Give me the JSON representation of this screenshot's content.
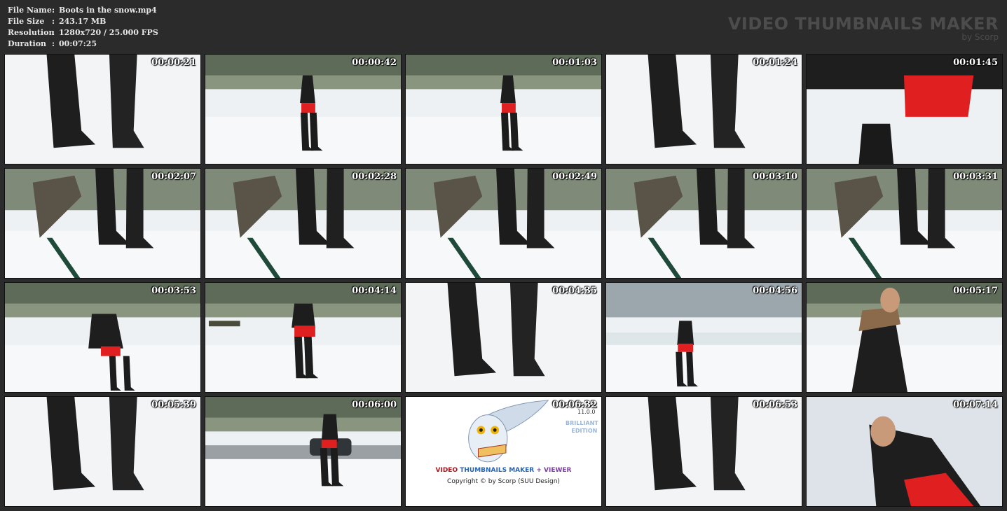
{
  "file_info": {
    "file_name_label": "File Name",
    "file_name": "Boots in the snow.mp4",
    "file_size_label": "File Size",
    "file_size": "243.17 MB",
    "resolution_label": "Resolution",
    "resolution": "1280x720 / 25.000 FPS",
    "duration_label": "Duration",
    "duration": "00:07:25",
    "separator": ":"
  },
  "brand": {
    "title": "VIDEO THUMBNAILS MAKER",
    "subtitle": "by Scorp"
  },
  "thumbnails": [
    {
      "time": "00:00:21",
      "scene": "boots-closeup"
    },
    {
      "time": "00:00:42",
      "scene": "walking-park"
    },
    {
      "time": "00:01:03",
      "scene": "walking-bag"
    },
    {
      "time": "00:01:24",
      "scene": "boots-closeup"
    },
    {
      "time": "00:01:45",
      "scene": "skirt-bag"
    },
    {
      "time": "00:02:07",
      "scene": "bench-boots"
    },
    {
      "time": "00:02:28",
      "scene": "bench-boots"
    },
    {
      "time": "00:02:49",
      "scene": "bench-boots"
    },
    {
      "time": "00:03:10",
      "scene": "bench-boots"
    },
    {
      "time": "00:03:31",
      "scene": "bench-boots"
    },
    {
      "time": "00:03:53",
      "scene": "woman-bag"
    },
    {
      "time": "00:04:14",
      "scene": "walking-away"
    },
    {
      "time": "00:04:35",
      "scene": "boots-closeup"
    },
    {
      "time": "00:04:56",
      "scene": "pond-walk"
    },
    {
      "time": "00:05:17",
      "scene": "portrait"
    },
    {
      "time": "00:05:39",
      "scene": "boots-closeup"
    },
    {
      "time": "00:06:00",
      "scene": "road-walk"
    },
    {
      "time": "00:06:32",
      "scene": "logo"
    },
    {
      "time": "00:06:53",
      "scene": "boots-closeup"
    },
    {
      "time": "00:07:14",
      "scene": "portrait-smile"
    }
  ],
  "logo": {
    "line1_a": "VIDEO ",
    "line1_b": "THUMBNAILS MAKER",
    "line1_c": " + VIEWER",
    "line2": "Copyright © by Scorp (SUU Design)",
    "version": "11.0.0",
    "edition_1": "BRILLIANT",
    "edition_2": "EDITION"
  },
  "colors": {
    "background": "#2b2b2b",
    "skirt": "#e02020",
    "boots": "#1a1a1a",
    "snow": "#f4f6f8"
  }
}
